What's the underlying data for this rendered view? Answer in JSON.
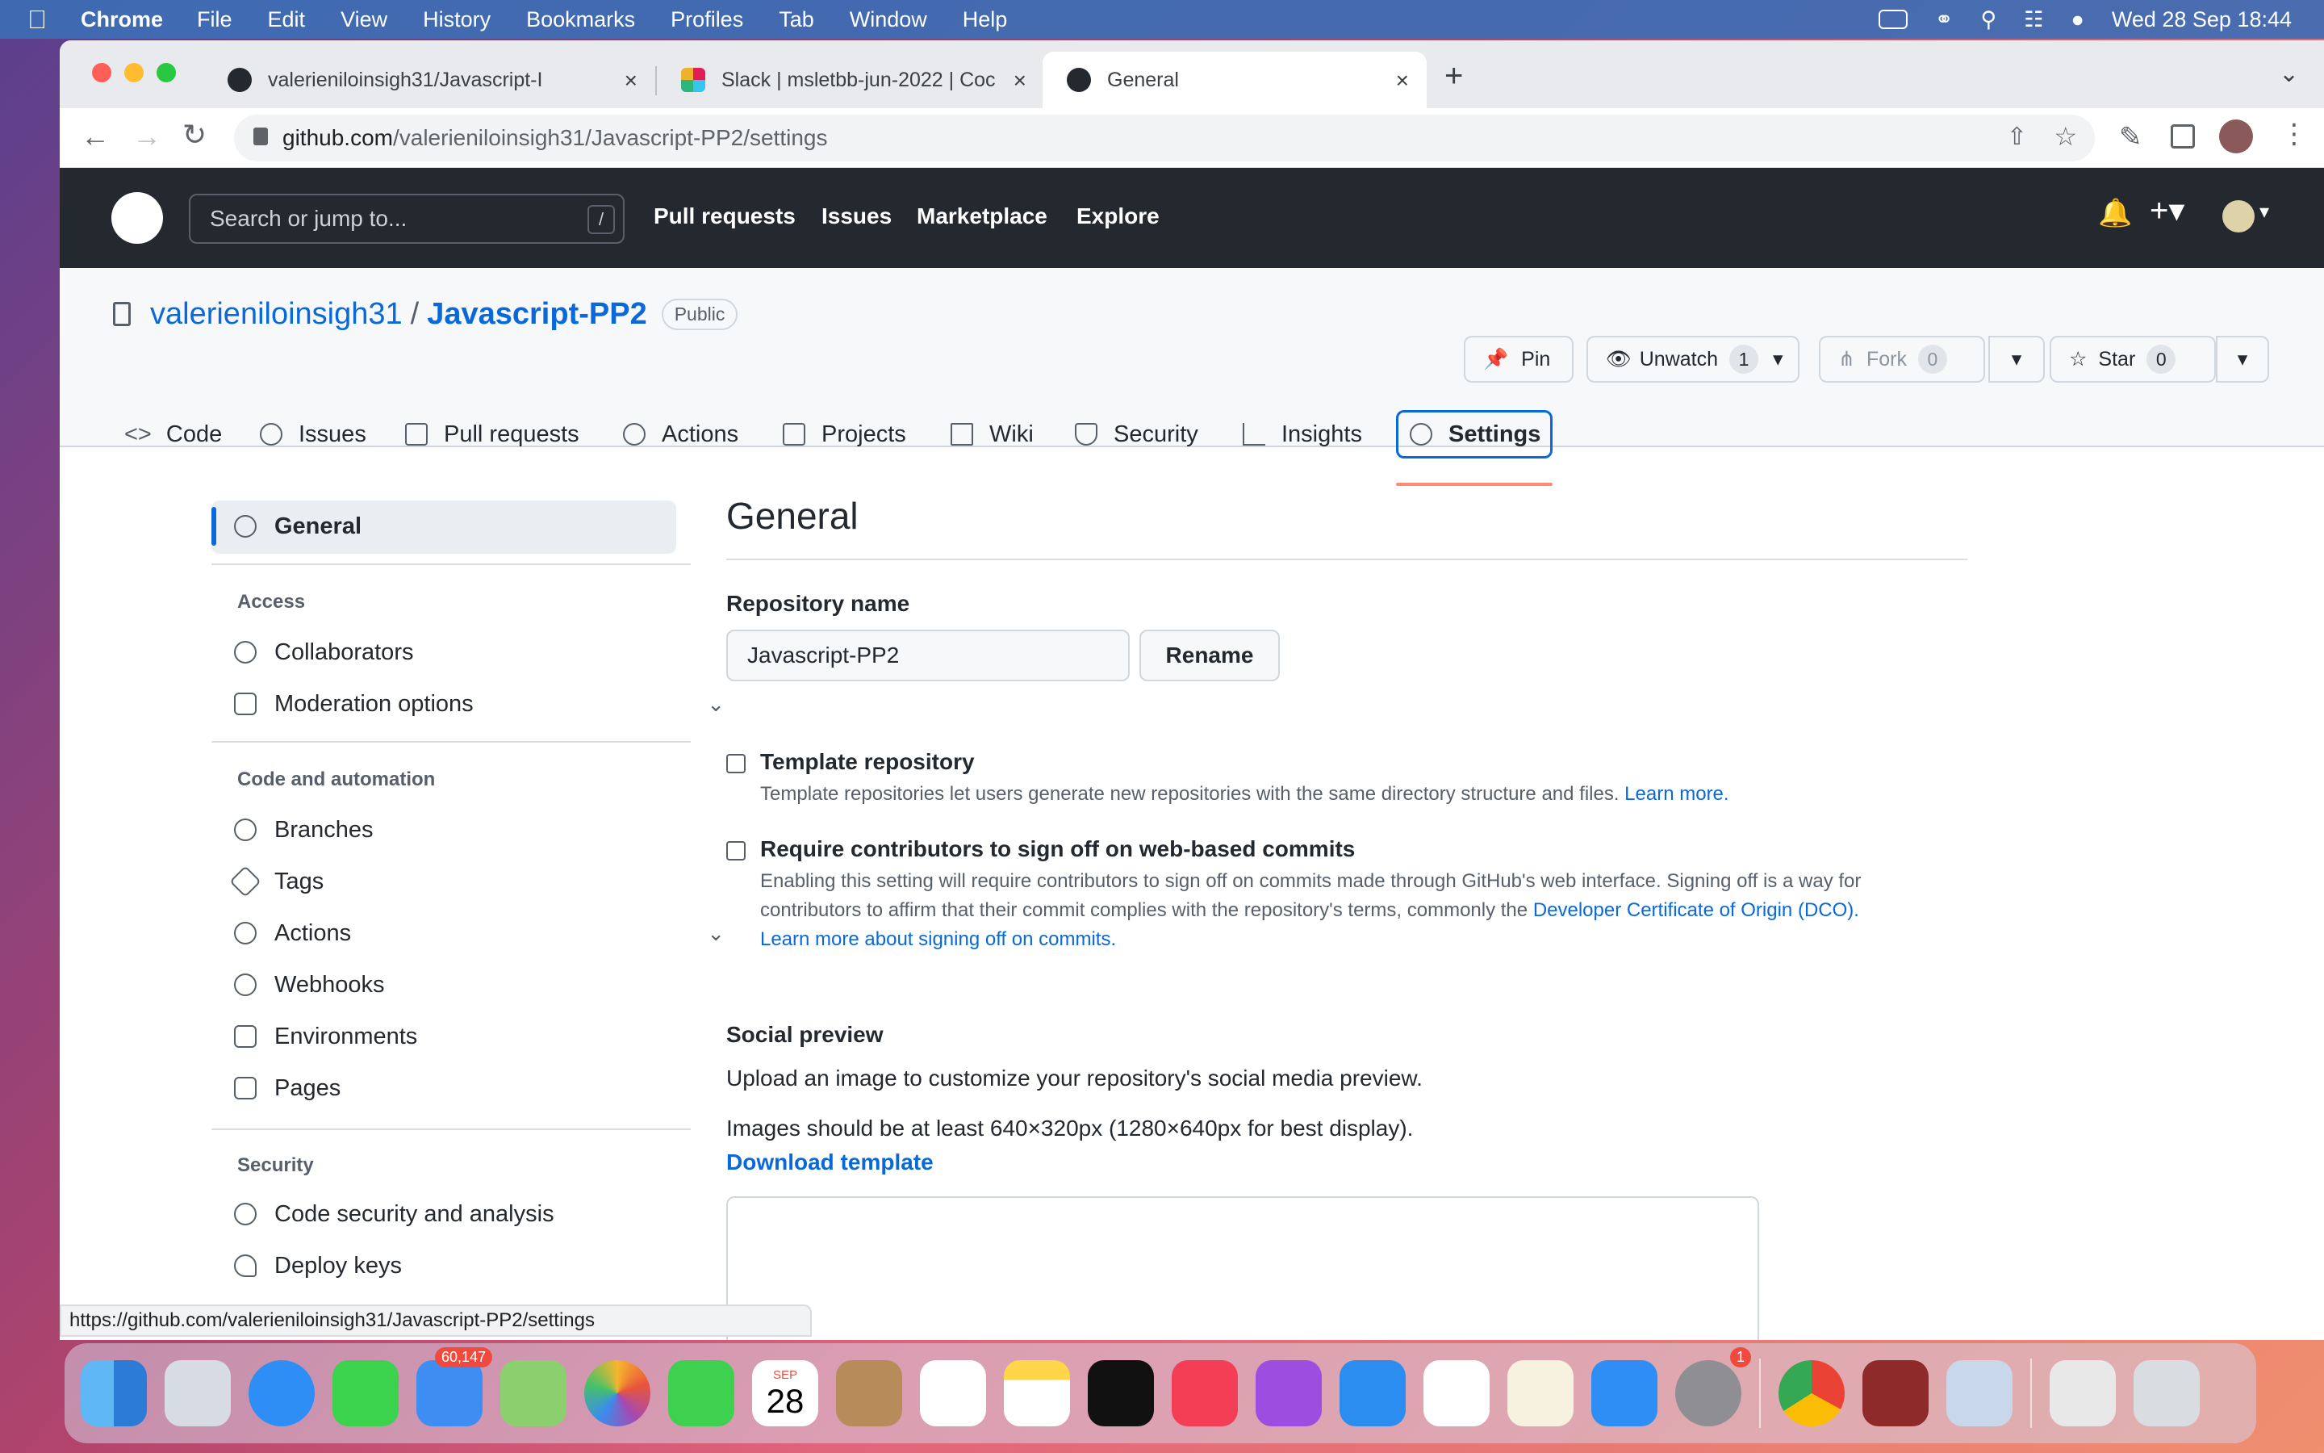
{
  "menubar": {
    "app": "Chrome",
    "items": [
      "File",
      "Edit",
      "View",
      "History",
      "Bookmarks",
      "Profiles",
      "Tab",
      "Window",
      "Help"
    ],
    "datetime": "Wed 28 Sep  18:44"
  },
  "browser": {
    "tabs": [
      {
        "title": "valerieniloinsigh31/Javascript-I"
      },
      {
        "title": "Slack | msletbb-jun-2022 | Coc"
      },
      {
        "title": "General"
      }
    ],
    "url_host": "github.com",
    "url_path": "/valerieniloinsigh31/Javascript-PP2/settings",
    "status_url": "https://github.com/valerieniloinsigh31/Javascript-PP2/settings"
  },
  "github": {
    "search_placeholder": "Search or jump to...",
    "search_key": "/",
    "nav": [
      "Pull requests",
      "Issues",
      "Marketplace",
      "Explore"
    ]
  },
  "repo": {
    "owner": "valerieniloinsigh31",
    "sep": "/",
    "name": "Javascript-PP2",
    "visibility": "Public",
    "pin": "Pin",
    "unwatch": "Unwatch",
    "watch_count": "1",
    "fork": "Fork",
    "fork_count": "0",
    "star": "Star",
    "star_count": "0",
    "tabs": [
      "Code",
      "Issues",
      "Pull requests",
      "Actions",
      "Projects",
      "Wiki",
      "Security",
      "Insights",
      "Settings"
    ]
  },
  "sidebar": {
    "general": "General",
    "access_head": "Access",
    "collaborators": "Collaborators",
    "moderation": "Moderation options",
    "code_head": "Code and automation",
    "branches": "Branches",
    "tags": "Tags",
    "actions": "Actions",
    "webhooks": "Webhooks",
    "environments": "Environments",
    "pages": "Pages",
    "security_head": "Security",
    "code_security": "Code security and analysis",
    "deploy_keys": "Deploy keys"
  },
  "main": {
    "title": "General",
    "repo_name_label": "Repository name",
    "repo_name_value": "Javascript-PP2",
    "rename": "Rename",
    "template_label": "Template repository",
    "template_desc": "Template repositories let users generate new repositories with the same directory structure and files.",
    "template_link": "Learn more.",
    "signoff_label": "Require contributors to sign off on web-based commits",
    "signoff_desc1": "Enabling this setting will require contributors to sign off on commits made through GitHub's web interface. Signing off is a way for",
    "signoff_desc2": "contributors to affirm that their commit complies with the repository's terms, commonly the",
    "signoff_link1": "Developer Certificate of Origin (DCO).",
    "signoff_link2": "Learn more about signing off on commits.",
    "social_label": "Social preview",
    "social_desc": "Upload an image to customize your repository's social media preview.",
    "social_size": "Images should be at least 640×320px (1280×640px for best display).",
    "download": "Download template"
  },
  "dock": {
    "mail_badge": "60,147",
    "cal_month": "SEP",
    "cal_day": "28",
    "settings_badge": "1"
  }
}
